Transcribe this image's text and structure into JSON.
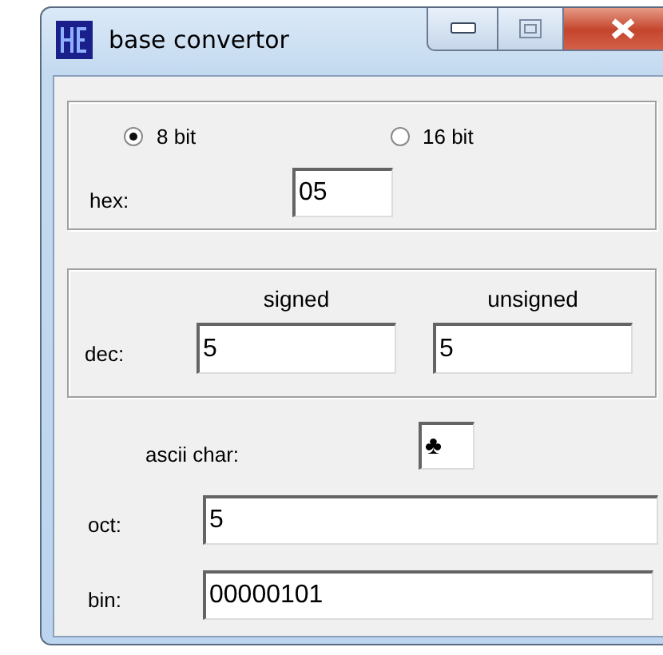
{
  "window": {
    "title": "base convertor"
  },
  "bits": [
    {
      "label": "8 bit",
      "selected": true
    },
    {
      "label": "16 bit",
      "selected": false
    }
  ],
  "hex": {
    "label": "hex:",
    "value": "05"
  },
  "dec": {
    "label": "dec:",
    "fields": [
      {
        "heading": "signed",
        "value": "5"
      },
      {
        "heading": "unsigned",
        "value": "5"
      }
    ]
  },
  "ascii": {
    "label": "ascii char:",
    "value": "♣"
  },
  "oct": {
    "label": "oct:",
    "value": "5"
  },
  "bin": {
    "label": "bin:",
    "value": "00000101"
  }
}
